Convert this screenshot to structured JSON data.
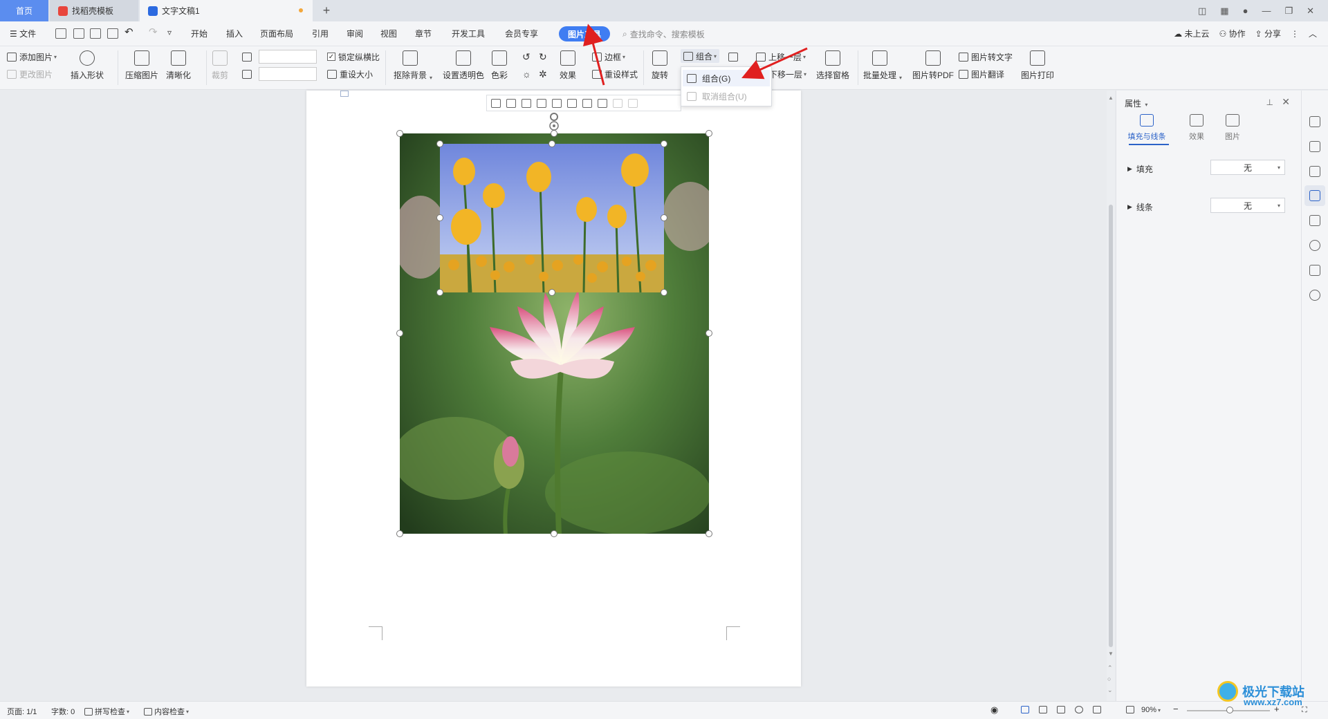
{
  "tabs": {
    "home": "首页",
    "template": "找稻壳模板",
    "doc": "文字文稿1",
    "add": "+"
  },
  "menu": {
    "file": "文件",
    "items": [
      "开始",
      "插入",
      "页面布局",
      "引用",
      "审阅",
      "视图",
      "章节",
      "开发工具",
      "会员专享"
    ],
    "picture_tools": "图片工具",
    "search_placeholder": "查找命令、搜索模板",
    "cloud": "未上云",
    "collab": "协作",
    "share": "分享"
  },
  "ribbon": {
    "add_picture": "添加图片",
    "change_picture": "更改图片",
    "insert_shape": "插入形状",
    "compress": "压缩图片",
    "sharpen": "清晰化",
    "crop": "裁剪",
    "lock_ratio": "锁定纵横比",
    "lock_ratio_checked": true,
    "reset_size": "重设大小",
    "remove_bg": "抠除背景",
    "set_transparent": "设置透明色",
    "color": "色彩",
    "effects": "效果",
    "border": "边框",
    "reset_style": "重设样式",
    "rotate": "旋转",
    "group": "组合",
    "bring_forward": "上移一层",
    "send_backward": "下移一层",
    "selection_pane": "选择窗格",
    "batch": "批量处理",
    "to_pdf": "图片转PDF",
    "to_text": "图片转文字",
    "translate": "图片翻译",
    "print": "图片打印"
  },
  "group_dropdown": {
    "group": "组合(G)",
    "ungroup": "取消组合(U)"
  },
  "properties": {
    "title": "属性",
    "tabs": [
      "填充与线条",
      "效果",
      "图片"
    ],
    "fill_label": "填充",
    "fill_value": "无",
    "line_label": "线条",
    "line_value": "无"
  },
  "status": {
    "page": "页面: 1/1",
    "words": "字数: 0",
    "spell": "拼写检查",
    "content": "内容检查",
    "zoom": "90%"
  },
  "watermark": {
    "name": "极光下载站",
    "url": "www.xz7.com"
  },
  "colors": {
    "accent": "#3f7df2",
    "home_tab": "#5b8def",
    "arrow": "#e02020"
  }
}
